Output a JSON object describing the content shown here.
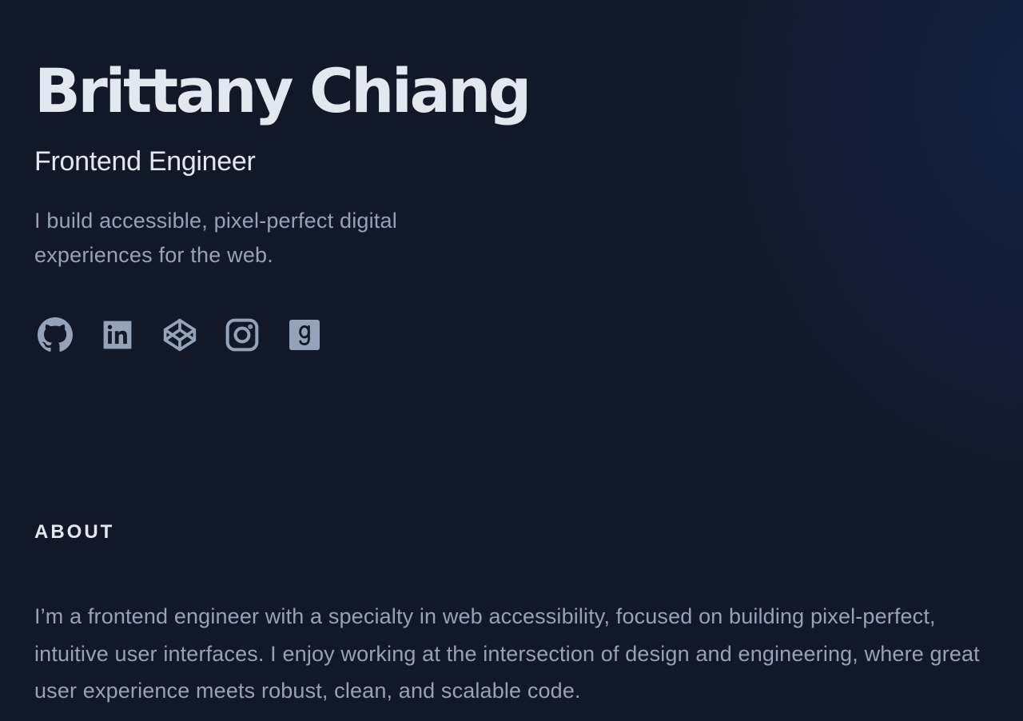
{
  "header": {
    "name": "Brittany Chiang",
    "role": "Frontend Engineer",
    "tagline": "I build accessible, pixel-perfect digital experiences for the web."
  },
  "socials": [
    {
      "icon": "github-icon",
      "label": "GitHub"
    },
    {
      "icon": "linkedin-icon",
      "label": "LinkedIn"
    },
    {
      "icon": "codepen-icon",
      "label": "CodePen"
    },
    {
      "icon": "instagram-icon",
      "label": "Instagram"
    },
    {
      "icon": "goodreads-icon",
      "label": "Goodreads"
    }
  ],
  "about": {
    "title": "About",
    "text": "I’m a frontend engineer with a specialty in web accessibility, focused on building pixel-perfect, intuitive user interfaces. I enjoy working at the intersection of design and engineering, where great user experience meets robust, clean, and scalable code."
  },
  "colors": {
    "background": "#111827",
    "heading": "#e2e8f0",
    "body_text": "#94a3b8",
    "icon": "#94a3b8"
  }
}
